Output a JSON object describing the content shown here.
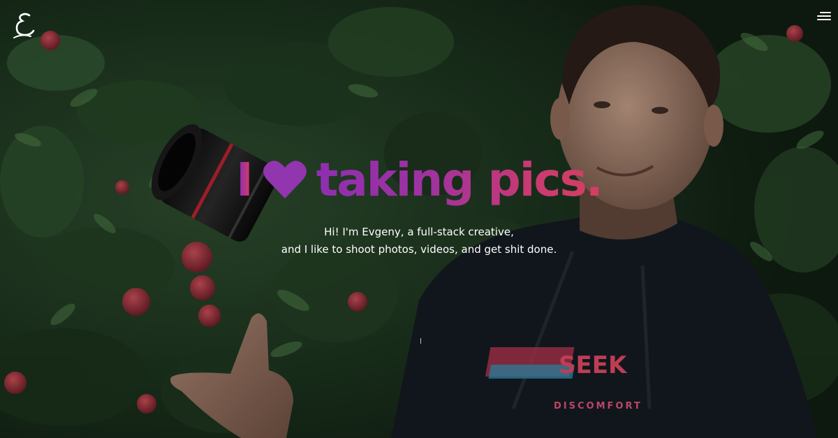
{
  "header": {
    "logo_text": "E",
    "menu_icon": "hamburger-menu-icon"
  },
  "hero": {
    "headline_start": "I",
    "heart_icon": "heart-icon",
    "headline_end": "taking pics.",
    "subtitle_line1": "Hi! I'm Evgeny, a full-stack creative,",
    "subtitle_line2": "and I like to shoot photos, videos, and get shit done.",
    "scroll_icon": "scroll-down-indicator-icon"
  },
  "photo_shirt_print": {
    "line1": "SEEK",
    "line2": "DISCOMFORT"
  },
  "colors": {
    "gradient_start": "#8e2fb0",
    "gradient_end": "#d43f60",
    "text": "#ffffff",
    "foliage": "#1f3a22"
  }
}
